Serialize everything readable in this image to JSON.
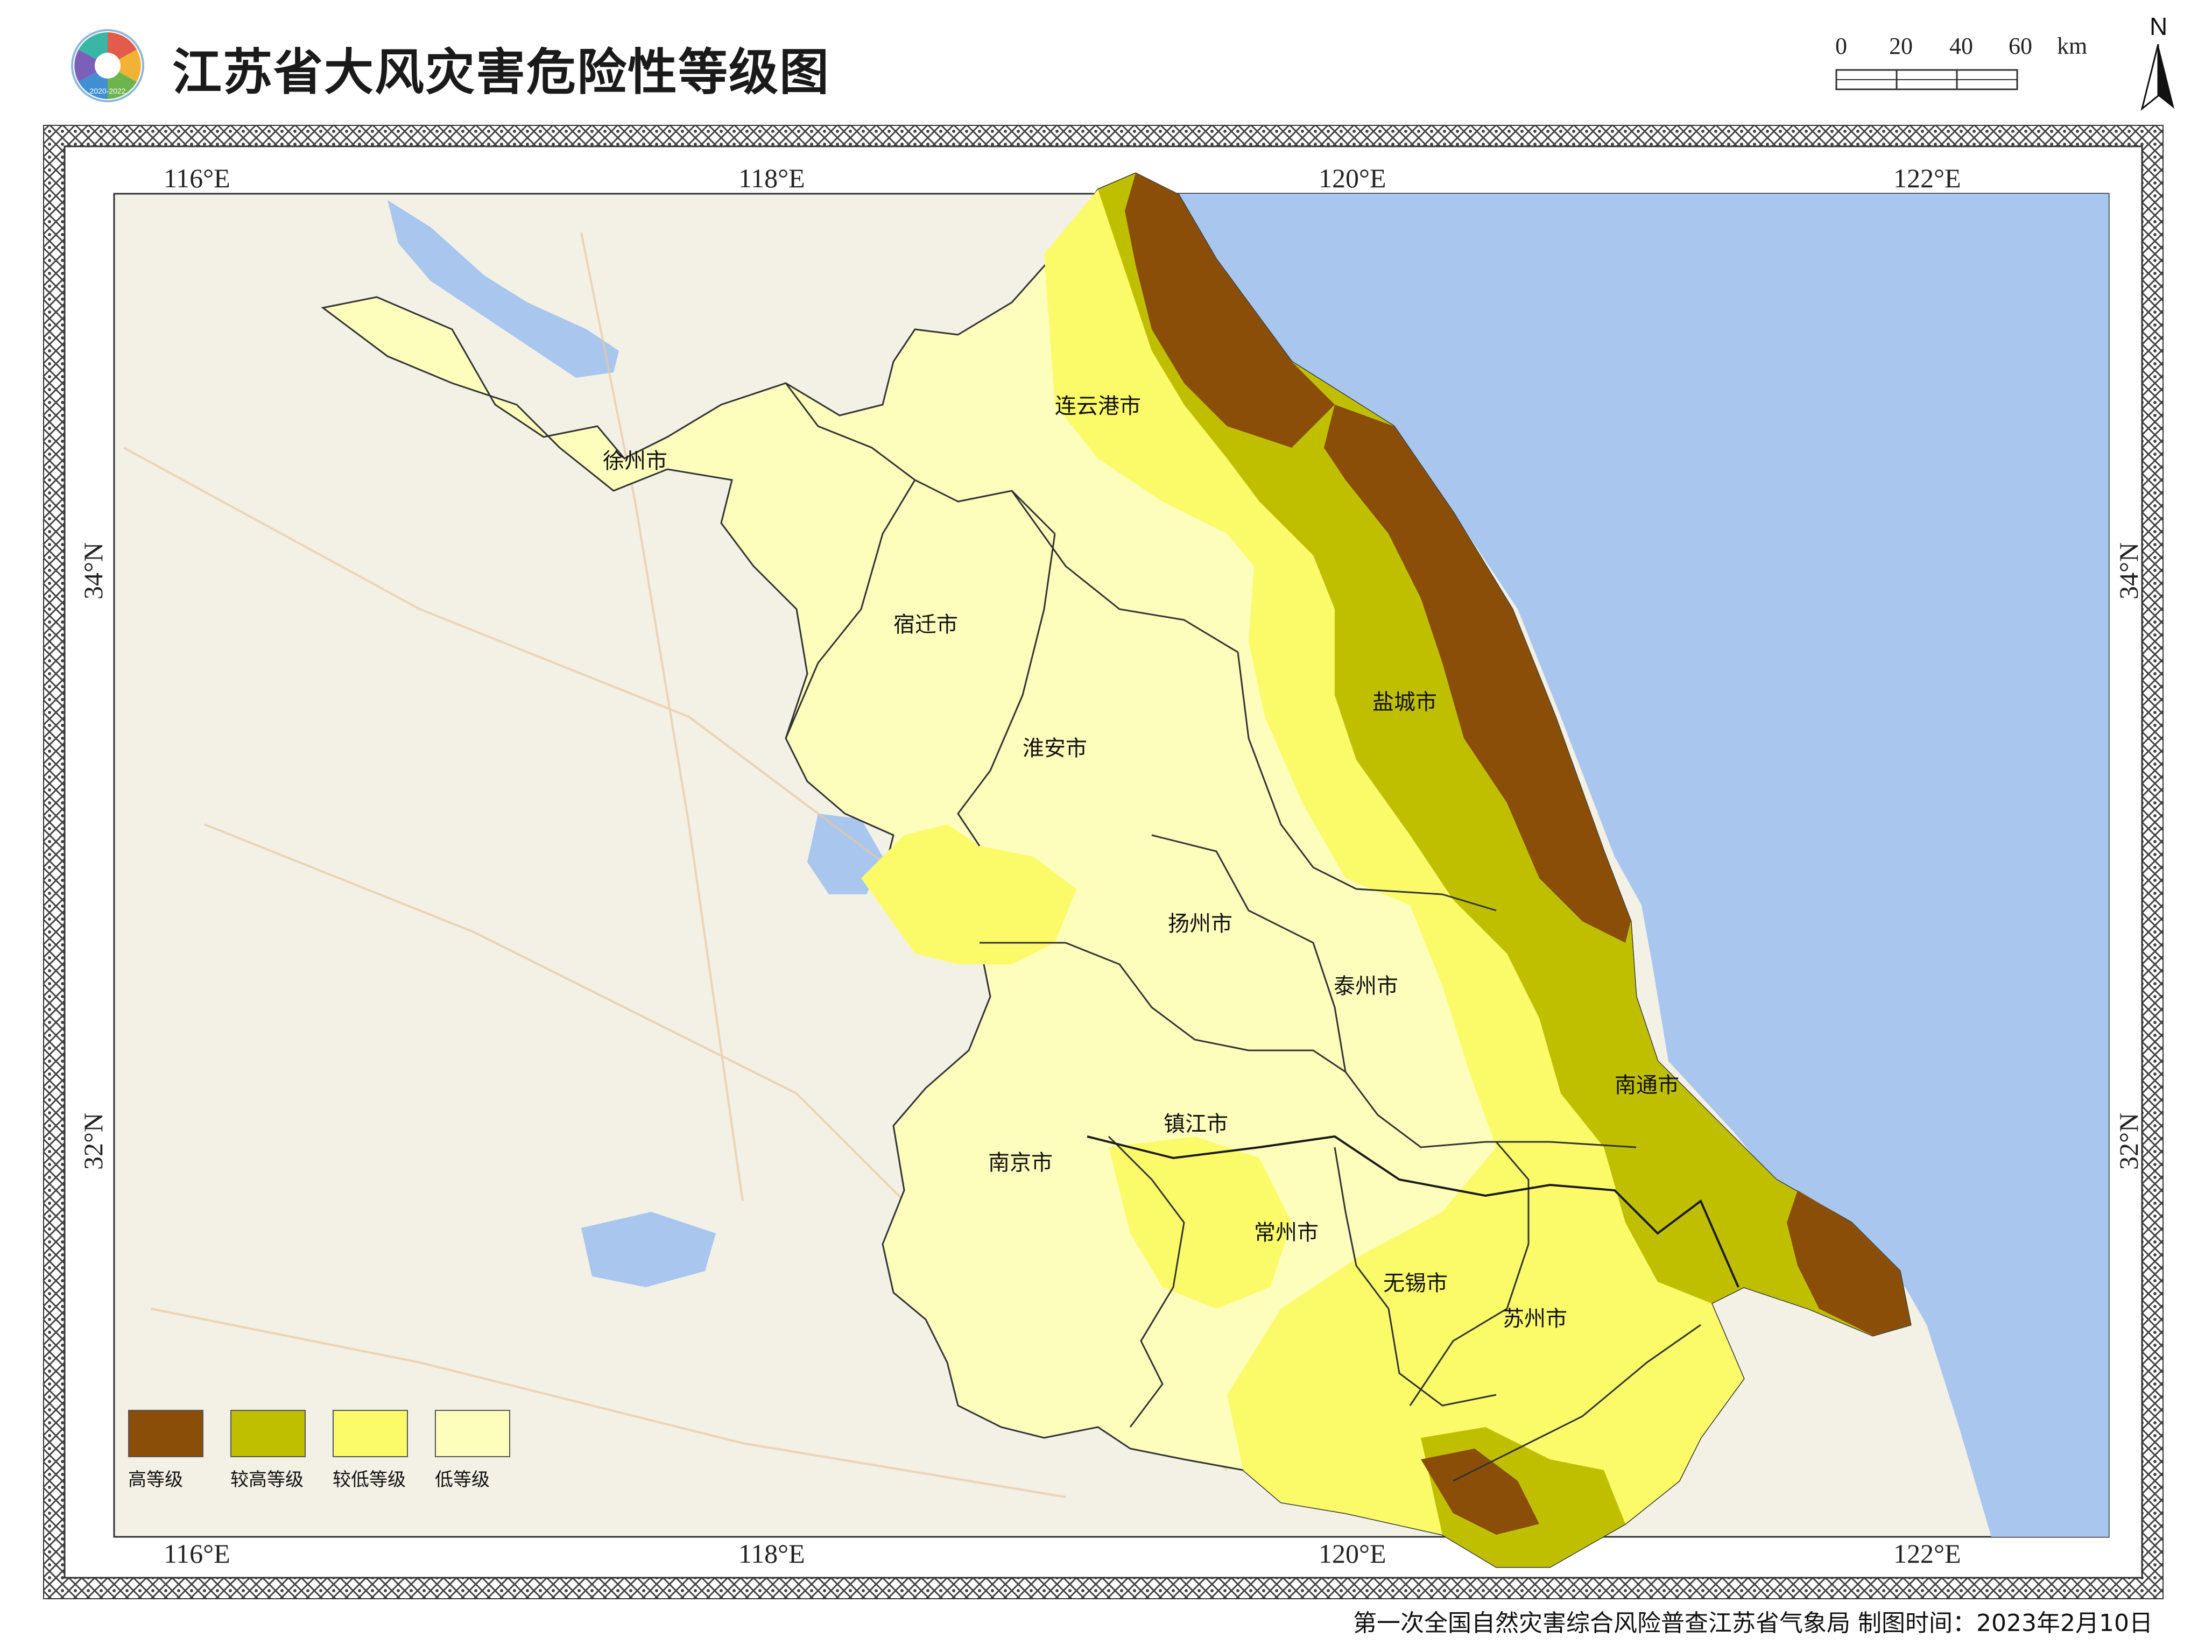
{
  "title": "江苏省大风灾害危险性等级图",
  "logo": {
    "icon": "census-logo-icon",
    "year_text": "2020-2022"
  },
  "scale": {
    "ticks": [
      "0",
      "20",
      "40",
      "60"
    ],
    "unit": "km"
  },
  "north": "N",
  "coords": {
    "lon_top": [
      "116°E",
      "118°E",
      "120°E",
      "122°E"
    ],
    "lon_bottom": [
      "116°E",
      "118°E",
      "120°E",
      "122°E"
    ],
    "lat_left": [
      "34°N",
      "32°N"
    ],
    "lat_right": [
      "34°N",
      "32°N"
    ]
  },
  "cities": [
    "徐州市",
    "连云港市",
    "宿迁市",
    "盐城市",
    "淮安市",
    "扬州市",
    "泰州市",
    "南通市",
    "镇江市",
    "南京市",
    "常州市",
    "无锡市",
    "苏州市"
  ],
  "legend": [
    {
      "label": "高等级",
      "color": "#8a4e08"
    },
    {
      "label": "较高等级",
      "color": "#bfbf00"
    },
    {
      "label": "较低等级",
      "color": "#fbfb6a"
    },
    {
      "label": "低等级",
      "color": "#fdfdbc"
    }
  ],
  "colors": {
    "sea": "#a8c6ee",
    "land_base": "#f3f0e6",
    "lake": "#a8c6ee"
  },
  "footer": "第一次全国自然灾害综合风险普查江苏省气象局 制图时间：2023年2月10日"
}
